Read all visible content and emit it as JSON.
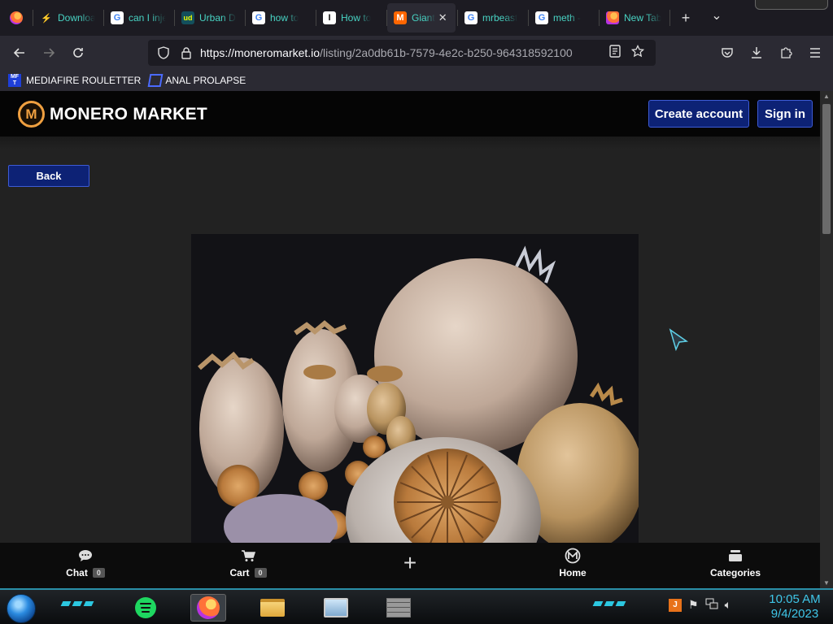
{
  "browser": {
    "tabs": [
      {
        "label": "Downloads",
        "fav": "flash",
        "fav_text": "⚡"
      },
      {
        "label": "can I inject",
        "fav": "g",
        "fav_text": "G"
      },
      {
        "label": "Urban Dictionary",
        "fav": "ud",
        "fav_text": "ud"
      },
      {
        "label": "how to",
        "fav": "g",
        "fav_text": "G"
      },
      {
        "label": "How to",
        "fav": "inst",
        "fav_text": "I"
      },
      {
        "label": "Giant",
        "fav": "m",
        "fav_text": "M",
        "active": true
      },
      {
        "label": "mrbeast",
        "fav": "g",
        "fav_text": "G"
      },
      {
        "label": "meth -",
        "fav": "g",
        "fav_text": "G"
      },
      {
        "label": "New Tab",
        "fav": "ff",
        "fav_text": ""
      }
    ],
    "tab_close_glyph": "✕",
    "new_tab_glyph": "+",
    "tab_list_glyph": "⌄",
    "url_host": "https://moneromarket.io",
    "url_path": "/listing/2a0db61b-7579-4e2c-b250-964318592100",
    "bookmarks": [
      {
        "label": "MEDIAFIRE ROULETTER",
        "fav_text": "MF T"
      },
      {
        "label": "ANAL PROLAPSE"
      }
    ]
  },
  "site": {
    "logo_text": "MONERO MARKET",
    "logo_mark": "M",
    "create_account": "Create account",
    "sign_in": "Sign in",
    "back": "Back"
  },
  "bottom_nav": {
    "chat_label": "Chat",
    "chat_count": "0",
    "cart_label": "Cart",
    "cart_count": "0",
    "add_glyph": "+",
    "home_label": "Home",
    "categories_label": "Categories"
  },
  "taskbar": {
    "time": "10:05 AM",
    "date": "9/4/2023"
  },
  "colors": {
    "accent_blue": "#0d2275",
    "logo_orange": "#f0a040",
    "tab_text": "#48d4c4",
    "clock": "#3fc6e8"
  }
}
